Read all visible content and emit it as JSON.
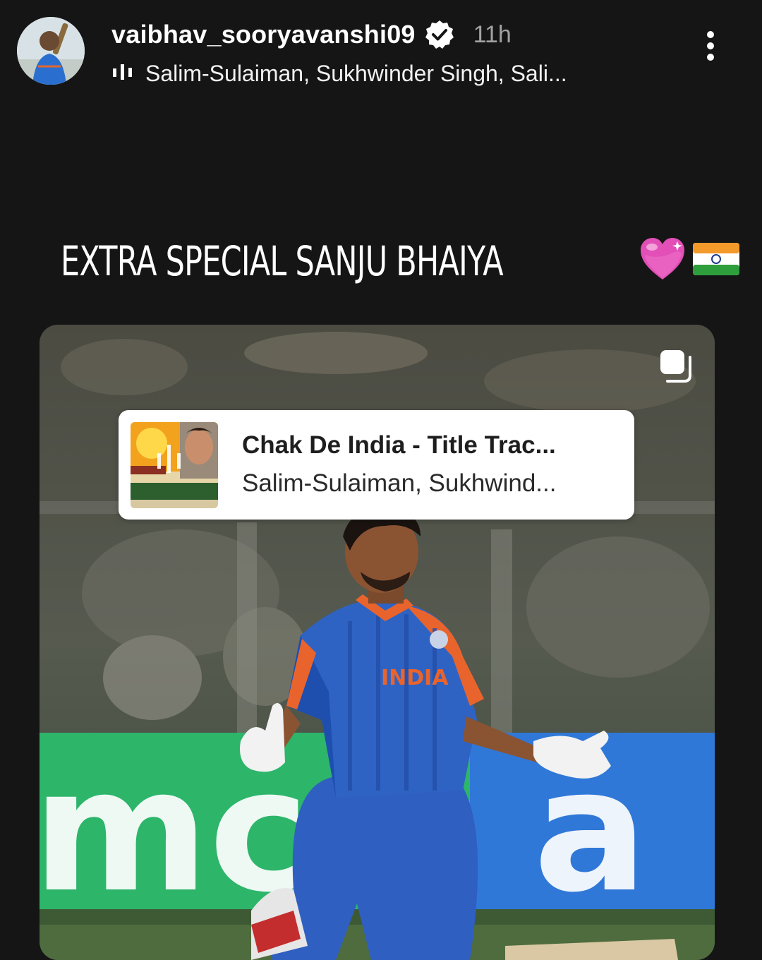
{
  "header": {
    "username": "vaibhav_sooryavanshi09",
    "timestamp": "11h",
    "audio_label": "Salim-Sulaiman, Sukhwinder Singh, Sali...",
    "verified_icon": "verified-badge-icon",
    "more_icon": "more-options-icon"
  },
  "caption": {
    "text": "EXTRA SPECIAL SANJU BHAIYA",
    "emojis": [
      "pink-heart-emoji",
      "india-flag-emoji"
    ]
  },
  "shared_post": {
    "multi_post_icon": "multiple-posts-icon",
    "jersey_text": "INDIA",
    "board_left_text": "mco",
    "board_right_text": "a",
    "music": {
      "title": "Chak De India - Title Trac...",
      "artist": "Salim-Sulaiman, Sukhwind..."
    }
  },
  "colors": {
    "background": "#151515",
    "sticker_bg": "#ffffff",
    "jersey_blue": "#2e63c4",
    "jersey_orange": "#e9642c",
    "board_green": "#2fbf6c",
    "board_blue": "#2a73d6"
  }
}
